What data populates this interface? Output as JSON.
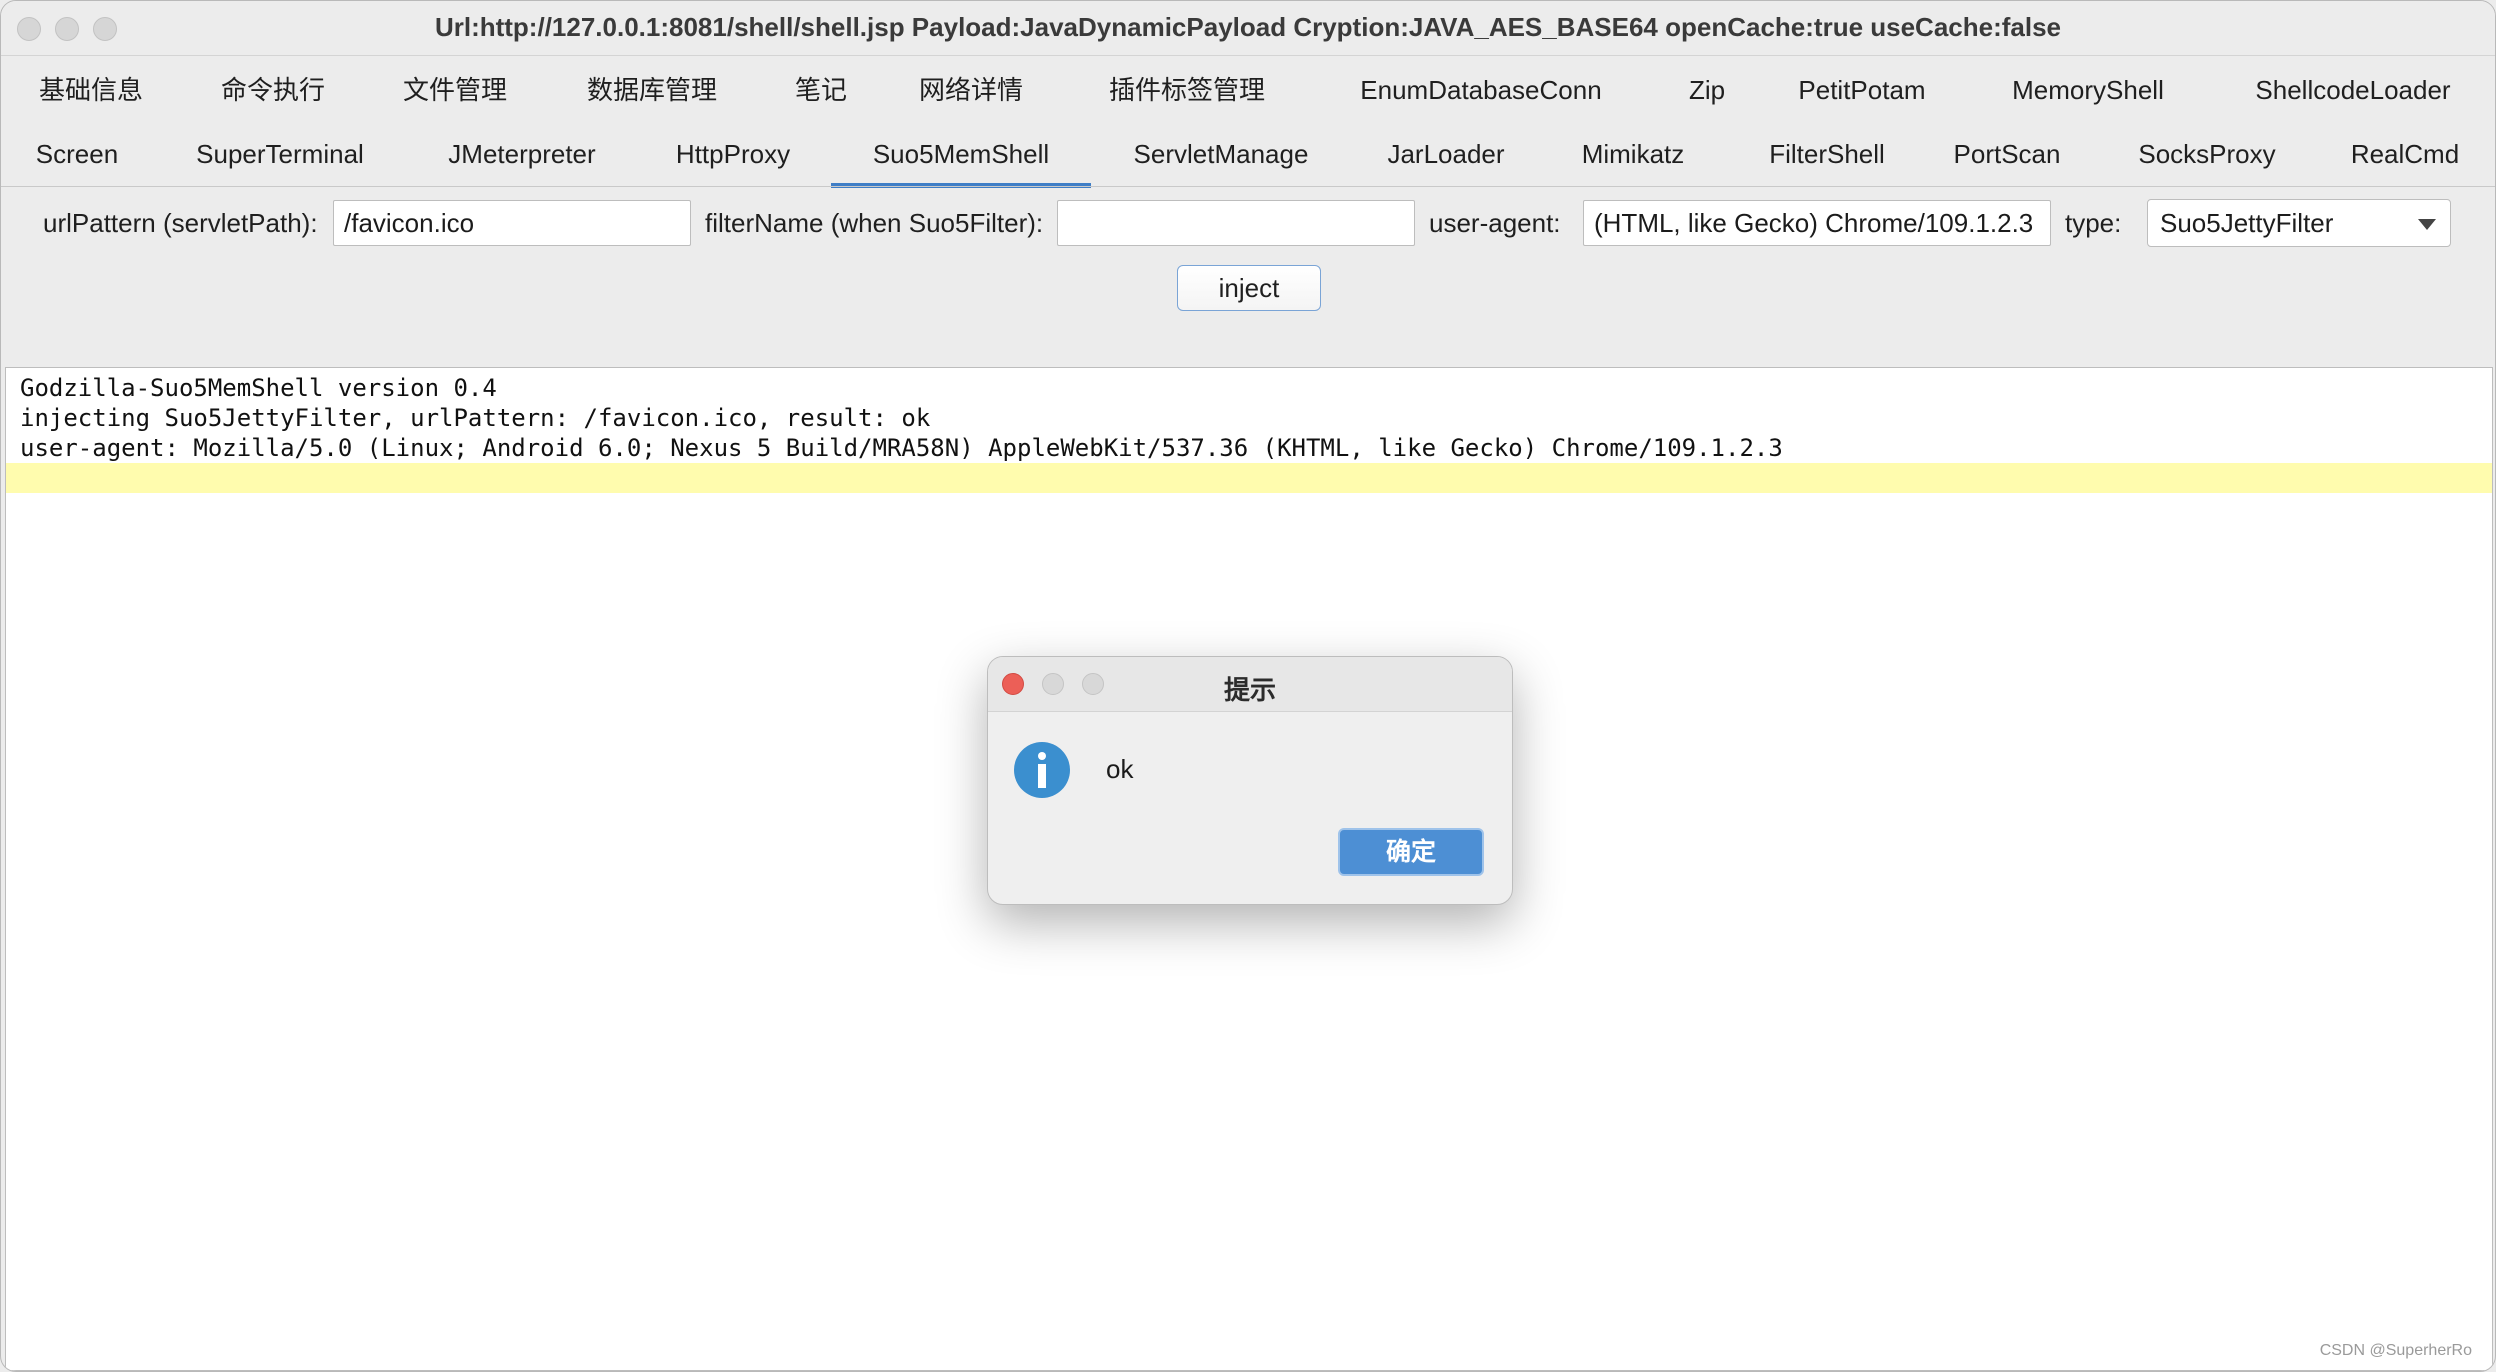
{
  "window": {
    "title": "Url:http://127.0.0.1:8081/shell/shell.jsp Payload:JavaDynamicPayload Cryption:JAVA_AES_BASE64 openCache:true useCache:false"
  },
  "tabs": {
    "row1": [
      "基础信息",
      "命令执行",
      "文件管理",
      "数据库管理",
      "笔记",
      "网络详情",
      "插件标签管理",
      "EnumDatabaseConn",
      "Zip",
      "PetitPotam",
      "MemoryShell",
      "ShellcodeLoader"
    ],
    "row2": [
      "Screen",
      "SuperTerminal",
      "JMeterpreter",
      "HttpProxy",
      "Suo5MemShell",
      "ServletManage",
      "JarLoader",
      "Mimikatz",
      "FilterShell",
      "PortScan",
      "SocksProxy",
      "RealCmd"
    ],
    "active": "Suo5MemShell"
  },
  "form": {
    "url_pattern_label": "urlPattern (servletPath):",
    "url_pattern_value": "/favicon.ico",
    "filter_name_label": "filterName (when Suo5Filter):",
    "filter_name_value": "",
    "user_agent_label": "user-agent:",
    "user_agent_value": "(HTML, like Gecko) Chrome/109.1.2.3",
    "type_label": "type:",
    "type_value": "Suo5JettyFilter",
    "inject_label": "inject"
  },
  "console": {
    "lines": [
      "Godzilla-Suo5MemShell version 0.4",
      "injecting Suo5JettyFilter, urlPattern: /favicon.ico, result: ok",
      "user-agent: Mozilla/5.0 (Linux; Android 6.0; Nexus 5 Build/MRA58N) AppleWebKit/537.36 (KHTML, like Gecko) Chrome/109.1.2.3"
    ],
    "watermark": "CSDN @SuperherRo"
  },
  "dialog": {
    "title": "提示",
    "message": "ok",
    "ok_label": "确定",
    "close_color": "#ec5f57"
  },
  "colors": {
    "accent": "#3f7ec6",
    "highlight": "#fffcae"
  }
}
